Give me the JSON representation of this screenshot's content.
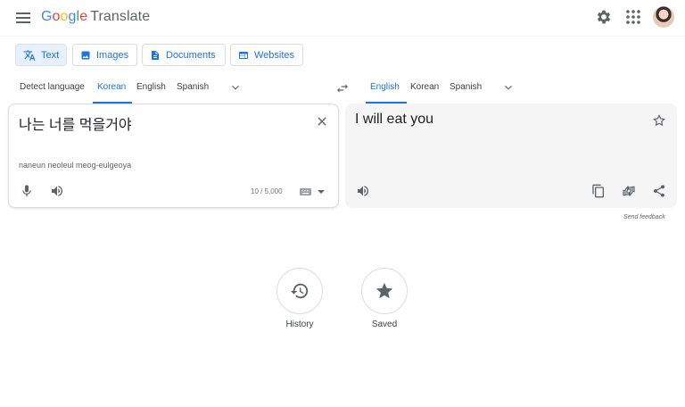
{
  "header": {
    "logo": {
      "letters": [
        "G",
        "o",
        "o",
        "g",
        "l",
        "e"
      ],
      "product": "Translate"
    },
    "icons": [
      "menu-icon",
      "settings-icon",
      "apps-icon"
    ]
  },
  "modes": [
    {
      "label": "Text",
      "icon": "translate-icon",
      "active": true
    },
    {
      "label": "Images",
      "icon": "image-icon",
      "active": false
    },
    {
      "label": "Documents",
      "icon": "document-icon",
      "active": false
    },
    {
      "label": "Websites",
      "icon": "website-icon",
      "active": false
    }
  ],
  "source_languages": [
    {
      "label": "Detect language",
      "active": false
    },
    {
      "label": "Korean",
      "active": true
    },
    {
      "label": "English",
      "active": false
    },
    {
      "label": "Spanish",
      "active": false
    }
  ],
  "target_languages": [
    {
      "label": "English",
      "active": true
    },
    {
      "label": "Korean",
      "active": false
    },
    {
      "label": "Spanish",
      "active": false
    }
  ],
  "source": {
    "text": "나는 너를 먹을거야",
    "transliteration": "naneun neoleul meog-eulgeoya",
    "char_count": "10 / 5,000"
  },
  "target": {
    "text": "I will eat you"
  },
  "send_feedback": "Send feedback",
  "bottom": {
    "history_label": "History",
    "saved_label": "Saved"
  },
  "colors": {
    "accent": "#1a73e8",
    "active_tab_bg": "#e8f0fe",
    "target_panel_bg": "#f5f5f5",
    "icon_gray": "#5f6368"
  }
}
